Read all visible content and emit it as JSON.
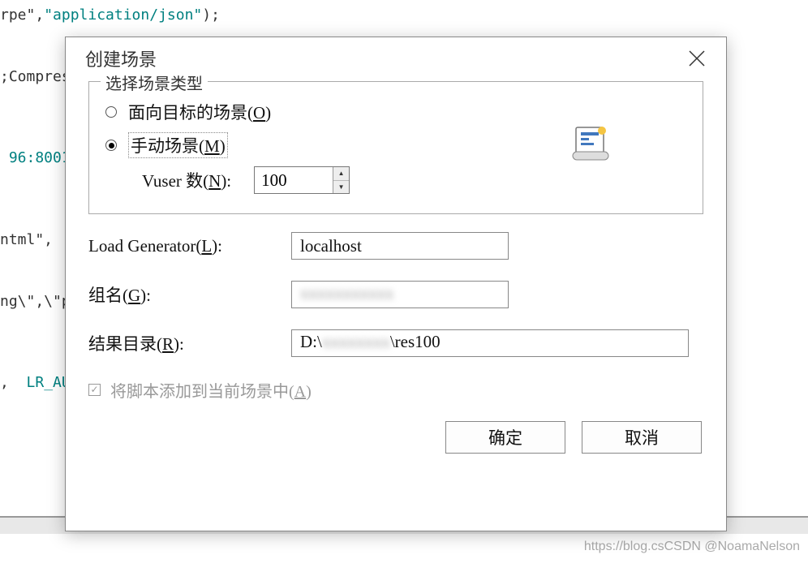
{
  "background_code": {
    "line1a": "rpe\",",
    "line1b": "\"application/json\"",
    "line1c": ");",
    "line2": ";Compres",
    "line3": " 96:8001",
    "line4": "ntml\",",
    "line5": "ng\\\",\\\"p",
    "line6a": ",  ",
    "line6b": "LR_AU"
  },
  "dialog": {
    "title": "创建场景",
    "fieldset_legend": "选择场景类型",
    "radio_goal": "面向目标的场景(",
    "radio_goal_key": "O",
    "radio_goal_end": ")",
    "radio_manual": "手动场景(",
    "radio_manual_key": "M",
    "radio_manual_end": ")",
    "vuser_label_pre": "Vuser 数(",
    "vuser_label_key": "N",
    "vuser_label_end": "):",
    "vuser_value": "100",
    "lg_label_pre": "Load Generator(",
    "lg_label_key": "L",
    "lg_label_end": "):",
    "lg_value": "localhost",
    "group_label_pre": "组名(",
    "group_label_key": "G",
    "group_label_end": "):",
    "group_value_blurred": "xxxxxxxxxxx",
    "result_label_pre": "结果目录(",
    "result_label_key": "R",
    "result_label_end": "):",
    "result_value_pre": "D:\\",
    "result_value_blurred": "xxxxxxxx",
    "result_value_post": "\\res100",
    "checkbox_label_pre": "将脚本添加到当前场景中(",
    "checkbox_label_key": "A",
    "checkbox_label_end": ")",
    "ok_button": "确定",
    "cancel_button": "取消"
  },
  "watermark": "https://blog.csCSDN @NoamaNelson"
}
